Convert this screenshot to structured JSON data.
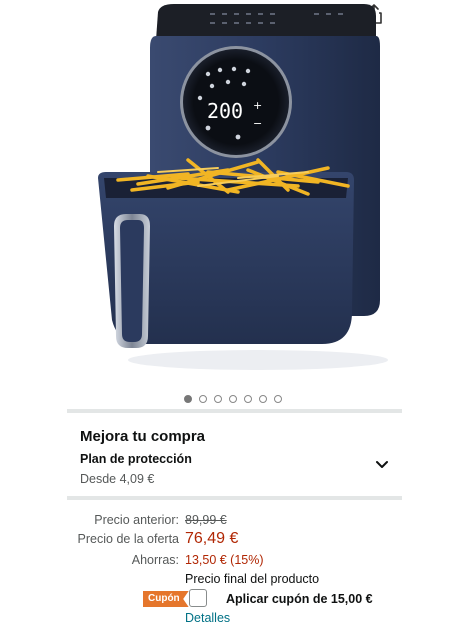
{
  "product": {
    "image_alt": "air-fryer",
    "display_temperature": "200",
    "colors": {
      "body": "#2a3a5e",
      "accent": "#e5762c",
      "price": "#b12704",
      "link": "#007185"
    }
  },
  "carousel": {
    "total": 7,
    "active_index": 0
  },
  "upgrade": {
    "title": "Mejora tu compra",
    "plan_title": "Plan de protección",
    "plan_price": "Desde 4,09 €"
  },
  "pricing": {
    "previous_label": "Precio anterior:",
    "previous_value": "89,99 €",
    "deal_label": "Precio de la oferta",
    "deal_value": "76,49 €",
    "savings_label": "Ahorras:",
    "savings_value": "13,50 € (15%)",
    "final_note": "Precio final del producto"
  },
  "coupon": {
    "badge": "Cupón",
    "apply_label": "Aplicar cupón de 15,00 €",
    "details_link": "Detalles"
  }
}
